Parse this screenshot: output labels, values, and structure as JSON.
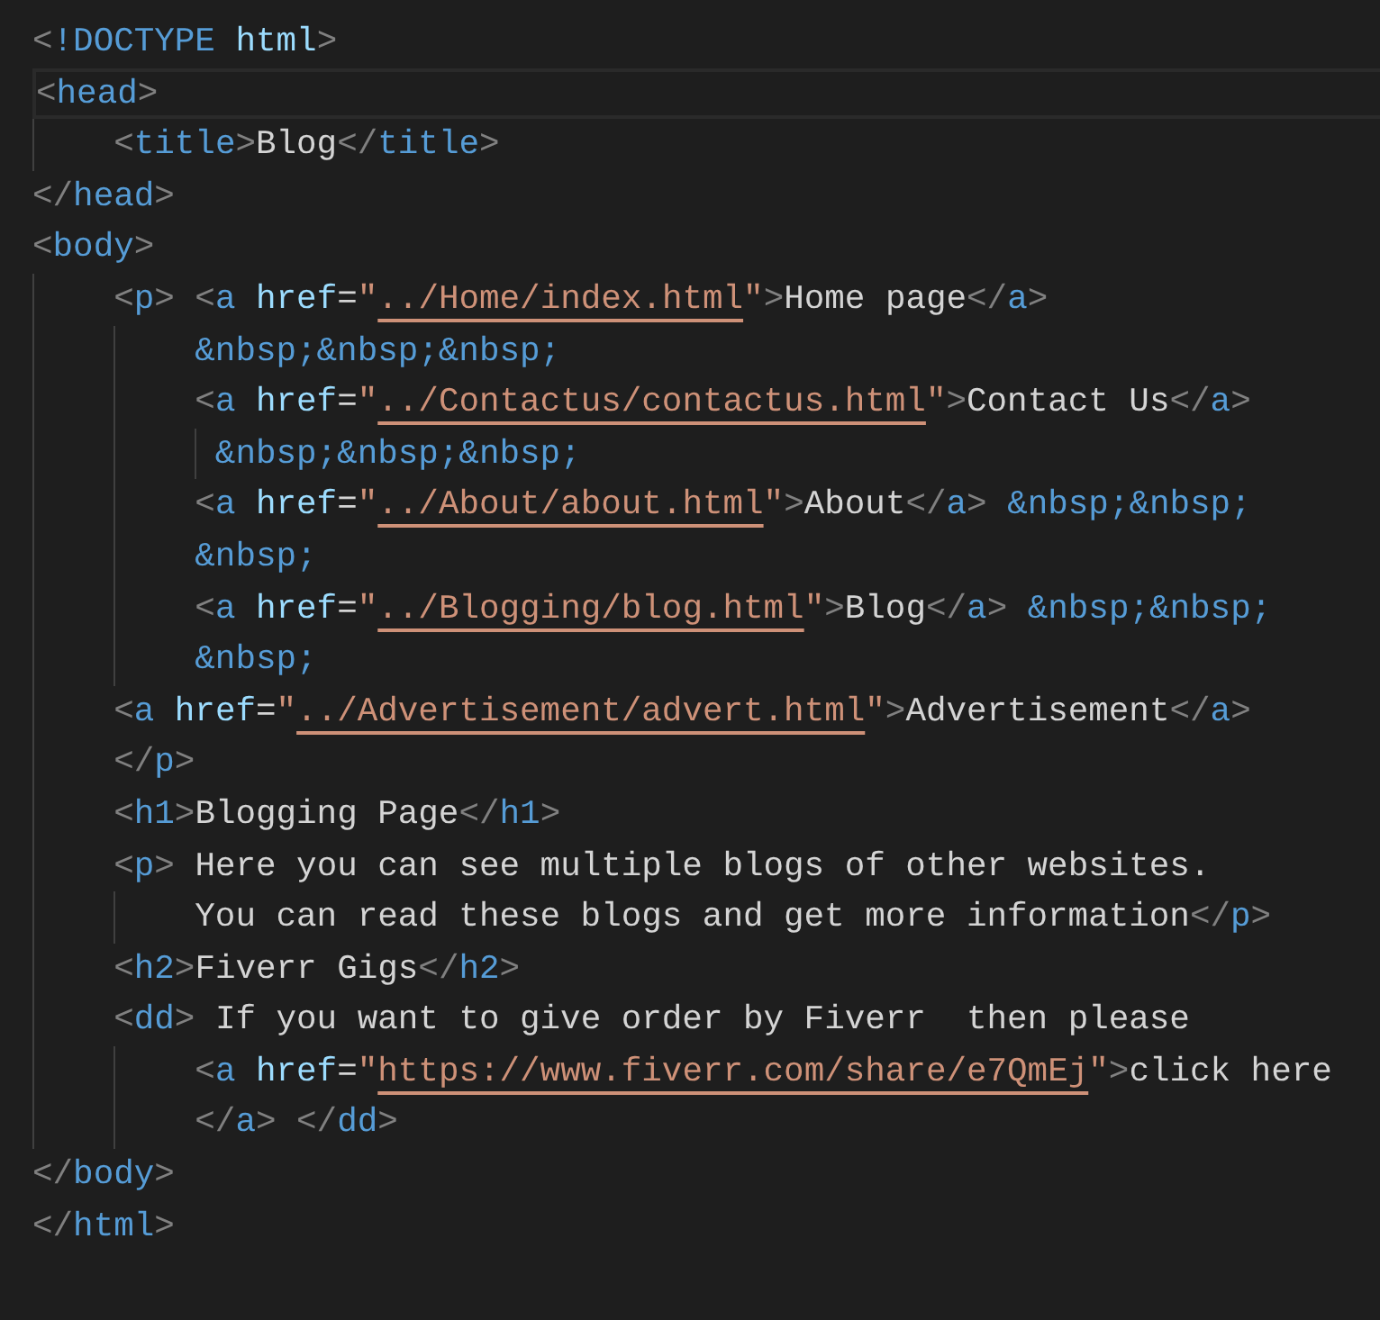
{
  "editor": {
    "lines": [
      {
        "current": false,
        "tokens": [
          {
            "kind": "punct",
            "text": "<"
          },
          {
            "kind": "tag",
            "text": "!DOCTYPE "
          },
          {
            "kind": "attr",
            "text": "html"
          },
          {
            "kind": "punct",
            "text": ">"
          }
        ]
      },
      {
        "current": true,
        "tokens": [
          {
            "kind": "punct",
            "text": "<"
          },
          {
            "kind": "tag",
            "text": "head"
          },
          {
            "kind": "punct",
            "text": ">"
          }
        ]
      },
      {
        "current": false,
        "tokens": [
          {
            "kind": "punct",
            "text": "    <"
          },
          {
            "kind": "tag",
            "text": "title"
          },
          {
            "kind": "punct",
            "text": ">"
          },
          {
            "kind": "text",
            "text": "Blog"
          },
          {
            "kind": "punct",
            "text": "</"
          },
          {
            "kind": "tag",
            "text": "title"
          },
          {
            "kind": "punct",
            "text": ">"
          }
        ]
      },
      {
        "current": false,
        "tokens": [
          {
            "kind": "punct",
            "text": "</"
          },
          {
            "kind": "tag",
            "text": "head"
          },
          {
            "kind": "punct",
            "text": ">"
          }
        ]
      },
      {
        "current": false,
        "tokens": [
          {
            "kind": "punct",
            "text": "<"
          },
          {
            "kind": "tag",
            "text": "body"
          },
          {
            "kind": "punct",
            "text": ">"
          }
        ]
      },
      {
        "current": false,
        "tokens": [
          {
            "kind": "punct",
            "text": "    <"
          },
          {
            "kind": "tag",
            "text": "p"
          },
          {
            "kind": "punct",
            "text": "> <"
          },
          {
            "kind": "tag",
            "text": "a"
          },
          {
            "kind": "attr",
            "text": " href"
          },
          {
            "kind": "text",
            "text": "="
          },
          {
            "kind": "string",
            "text": "\""
          },
          {
            "kind": "link",
            "text": "../Home/index.html"
          },
          {
            "kind": "string",
            "text": "\""
          },
          {
            "kind": "punct",
            "text": ">"
          },
          {
            "kind": "text",
            "text": "Home page"
          },
          {
            "kind": "punct",
            "text": "</"
          },
          {
            "kind": "tag",
            "text": "a"
          },
          {
            "kind": "punct",
            "text": ">"
          }
        ]
      },
      {
        "current": false,
        "tokens": [
          {
            "kind": "entity",
            "text": "        &nbsp;&nbsp;&nbsp;"
          }
        ]
      },
      {
        "current": false,
        "tokens": [
          {
            "kind": "punct",
            "text": "        <"
          },
          {
            "kind": "tag",
            "text": "a"
          },
          {
            "kind": "attr",
            "text": " href"
          },
          {
            "kind": "text",
            "text": "="
          },
          {
            "kind": "string",
            "text": "\""
          },
          {
            "kind": "link",
            "text": "../Contactus/contactus.html"
          },
          {
            "kind": "string",
            "text": "\""
          },
          {
            "kind": "punct",
            "text": ">"
          },
          {
            "kind": "text",
            "text": "Contact Us"
          },
          {
            "kind": "punct",
            "text": "</"
          },
          {
            "kind": "tag",
            "text": "a"
          },
          {
            "kind": "punct",
            "text": ">"
          }
        ]
      },
      {
        "current": false,
        "tokens": [
          {
            "kind": "entity",
            "text": "         &nbsp;&nbsp;&nbsp;"
          }
        ]
      },
      {
        "current": false,
        "tokens": [
          {
            "kind": "punct",
            "text": "        <"
          },
          {
            "kind": "tag",
            "text": "a"
          },
          {
            "kind": "attr",
            "text": " href"
          },
          {
            "kind": "text",
            "text": "="
          },
          {
            "kind": "string",
            "text": "\""
          },
          {
            "kind": "link",
            "text": "../About/about.html"
          },
          {
            "kind": "string",
            "text": "\""
          },
          {
            "kind": "punct",
            "text": ">"
          },
          {
            "kind": "text",
            "text": "About"
          },
          {
            "kind": "punct",
            "text": "</"
          },
          {
            "kind": "tag",
            "text": "a"
          },
          {
            "kind": "punct",
            "text": ">"
          },
          {
            "kind": "entity",
            "text": " &nbsp;&nbsp;"
          }
        ]
      },
      {
        "current": false,
        "tokens": [
          {
            "kind": "entity",
            "text": "        &nbsp;"
          }
        ]
      },
      {
        "current": false,
        "tokens": [
          {
            "kind": "punct",
            "text": "        <"
          },
          {
            "kind": "tag",
            "text": "a"
          },
          {
            "kind": "attr",
            "text": " href"
          },
          {
            "kind": "text",
            "text": "="
          },
          {
            "kind": "string",
            "text": "\""
          },
          {
            "kind": "link",
            "text": "../Blogging/blog.html"
          },
          {
            "kind": "string",
            "text": "\""
          },
          {
            "kind": "punct",
            "text": ">"
          },
          {
            "kind": "text",
            "text": "Blog"
          },
          {
            "kind": "punct",
            "text": "</"
          },
          {
            "kind": "tag",
            "text": "a"
          },
          {
            "kind": "punct",
            "text": ">"
          },
          {
            "kind": "entity",
            "text": " &nbsp;&nbsp;"
          }
        ]
      },
      {
        "current": false,
        "tokens": [
          {
            "kind": "entity",
            "text": "        &nbsp;"
          }
        ]
      },
      {
        "current": false,
        "tokens": [
          {
            "kind": "punct",
            "text": "    <"
          },
          {
            "kind": "tag",
            "text": "a"
          },
          {
            "kind": "attr",
            "text": " href"
          },
          {
            "kind": "text",
            "text": "="
          },
          {
            "kind": "string",
            "text": "\""
          },
          {
            "kind": "link",
            "text": "../Advertisement/advert.html"
          },
          {
            "kind": "string",
            "text": "\""
          },
          {
            "kind": "punct",
            "text": ">"
          },
          {
            "kind": "text",
            "text": "Advertisement"
          },
          {
            "kind": "punct",
            "text": "</"
          },
          {
            "kind": "tag",
            "text": "a"
          },
          {
            "kind": "punct",
            "text": ">"
          }
        ]
      },
      {
        "current": false,
        "tokens": [
          {
            "kind": "punct",
            "text": "    </"
          },
          {
            "kind": "tag",
            "text": "p"
          },
          {
            "kind": "punct",
            "text": ">"
          }
        ]
      },
      {
        "current": false,
        "tokens": [
          {
            "kind": "punct",
            "text": "    <"
          },
          {
            "kind": "tag",
            "text": "h1"
          },
          {
            "kind": "punct",
            "text": ">"
          },
          {
            "kind": "text",
            "text": "Blogging Page"
          },
          {
            "kind": "punct",
            "text": "</"
          },
          {
            "kind": "tag",
            "text": "h1"
          },
          {
            "kind": "punct",
            "text": ">"
          }
        ]
      },
      {
        "current": false,
        "tokens": [
          {
            "kind": "punct",
            "text": "    <"
          },
          {
            "kind": "tag",
            "text": "p"
          },
          {
            "kind": "punct",
            "text": ">"
          },
          {
            "kind": "text",
            "text": " Here you can see multiple blogs of other websites."
          }
        ]
      },
      {
        "current": false,
        "tokens": [
          {
            "kind": "text",
            "text": "        You can read these blogs and get more information"
          },
          {
            "kind": "punct",
            "text": "</"
          },
          {
            "kind": "tag",
            "text": "p"
          },
          {
            "kind": "punct",
            "text": ">"
          }
        ]
      },
      {
        "current": false,
        "tokens": [
          {
            "kind": "punct",
            "text": "    <"
          },
          {
            "kind": "tag",
            "text": "h2"
          },
          {
            "kind": "punct",
            "text": ">"
          },
          {
            "kind": "text",
            "text": "Fiverr Gigs"
          },
          {
            "kind": "punct",
            "text": "</"
          },
          {
            "kind": "tag",
            "text": "h2"
          },
          {
            "kind": "punct",
            "text": ">"
          }
        ]
      },
      {
        "current": false,
        "tokens": [
          {
            "kind": "punct",
            "text": "    <"
          },
          {
            "kind": "tag",
            "text": "dd"
          },
          {
            "kind": "punct",
            "text": ">"
          },
          {
            "kind": "text",
            "text": " If you want to give order by Fiverr  then please"
          }
        ]
      },
      {
        "current": false,
        "tokens": [
          {
            "kind": "punct",
            "text": "        <"
          },
          {
            "kind": "tag",
            "text": "a"
          },
          {
            "kind": "attr",
            "text": " href"
          },
          {
            "kind": "text",
            "text": "="
          },
          {
            "kind": "string",
            "text": "\""
          },
          {
            "kind": "link",
            "text": "https://www.fiverr.com/share/e7QmEj"
          },
          {
            "kind": "string",
            "text": "\""
          },
          {
            "kind": "punct",
            "text": ">"
          },
          {
            "kind": "text",
            "text": "click here"
          }
        ]
      },
      {
        "current": false,
        "tokens": [
          {
            "kind": "punct",
            "text": "        </"
          },
          {
            "kind": "tag",
            "text": "a"
          },
          {
            "kind": "punct",
            "text": "> </"
          },
          {
            "kind": "tag",
            "text": "dd"
          },
          {
            "kind": "punct",
            "text": ">"
          }
        ]
      },
      {
        "current": false,
        "tokens": [
          {
            "kind": "punct",
            "text": "</"
          },
          {
            "kind": "tag",
            "text": "body"
          },
          {
            "kind": "punct",
            "text": ">"
          }
        ]
      },
      {
        "current": false,
        "tokens": [
          {
            "kind": "punct",
            "text": "</"
          },
          {
            "kind": "tag",
            "text": "html"
          },
          {
            "kind": "punct",
            "text": ">"
          }
        ]
      }
    ]
  }
}
